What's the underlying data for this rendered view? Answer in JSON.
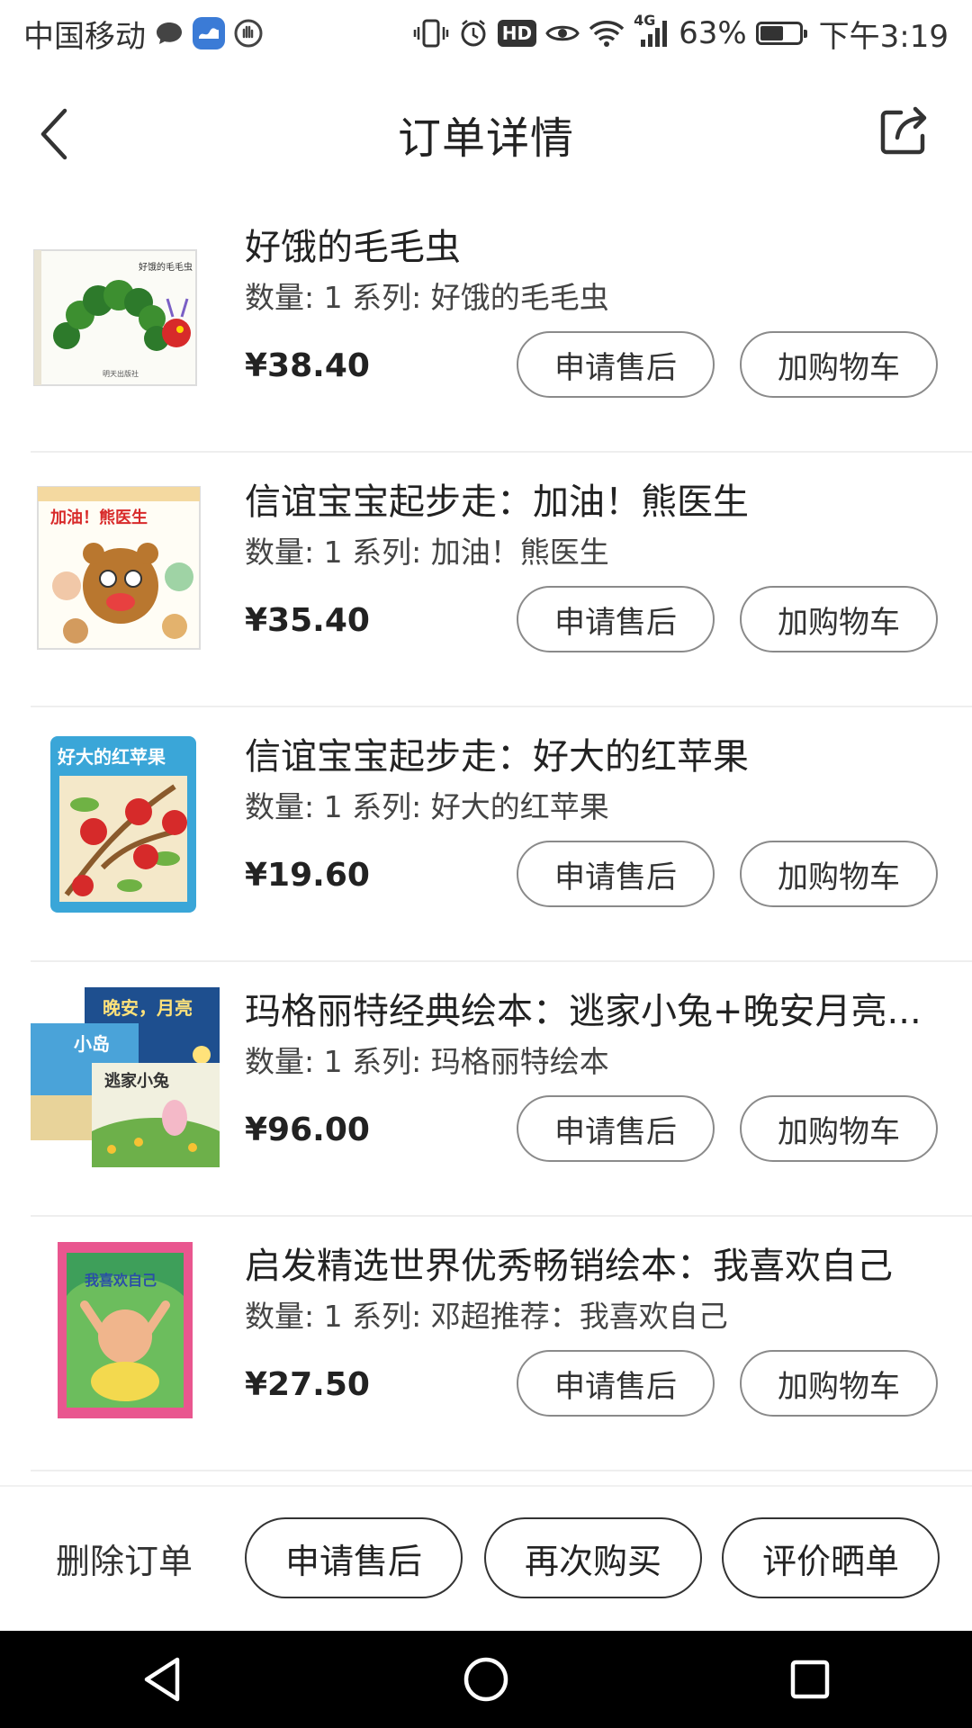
{
  "status_bar": {
    "carrier": "中国移动",
    "network": "4G",
    "battery": "63%",
    "battery_level": 0.63,
    "time": "下午3:19",
    "hd": "HD"
  },
  "header": {
    "title": "订单详情"
  },
  "items": [
    {
      "title": "好饿的毛毛虫",
      "meta": "数量: 1 系列: 好饿的毛毛虫",
      "price": "¥38.40",
      "after_sale": "申请售后",
      "add_cart": "加购物车"
    },
    {
      "title": "信谊宝宝起步走：加油！熊医生",
      "meta": "数量: 1 系列: 加油！熊医生",
      "price": "¥35.40",
      "after_sale": "申请售后",
      "add_cart": "加购物车"
    },
    {
      "title": "信谊宝宝起步走：好大的红苹果",
      "meta": "数量: 1 系列: 好大的红苹果",
      "price": "¥19.60",
      "after_sale": "申请售后",
      "add_cart": "加购物车"
    },
    {
      "title": "玛格丽特经典绘本：逃家小兔+晚安月亮...",
      "meta": "数量: 1 系列: 玛格丽特绘本",
      "price": "¥96.00",
      "after_sale": "申请售后",
      "add_cart": "加购物车"
    },
    {
      "title": "启发精选世界优秀畅销绘本：我喜欢自己",
      "meta": "数量: 1 系列: 邓超推荐：我喜欢自己",
      "price": "¥27.50",
      "after_sale": "申请售后",
      "add_cart": "加购物车"
    }
  ],
  "book_covers": {
    "caterpillar": "好饿的毛毛虫",
    "bear": "加油！熊医生",
    "apple": "好大的红苹果",
    "moon": "晚安，月亮",
    "island": "小岛",
    "rabbit": "逃家小兔",
    "myself": "我喜欢自己"
  },
  "actions": {
    "delete": "删除订单",
    "after_sale": "申请售后",
    "buy_again": "再次购买",
    "review": "评价晒单"
  },
  "colors": {
    "background": "#ffffff",
    "text": "#222222",
    "divider": "#eeeeee",
    "nav_bar": "#000000"
  }
}
